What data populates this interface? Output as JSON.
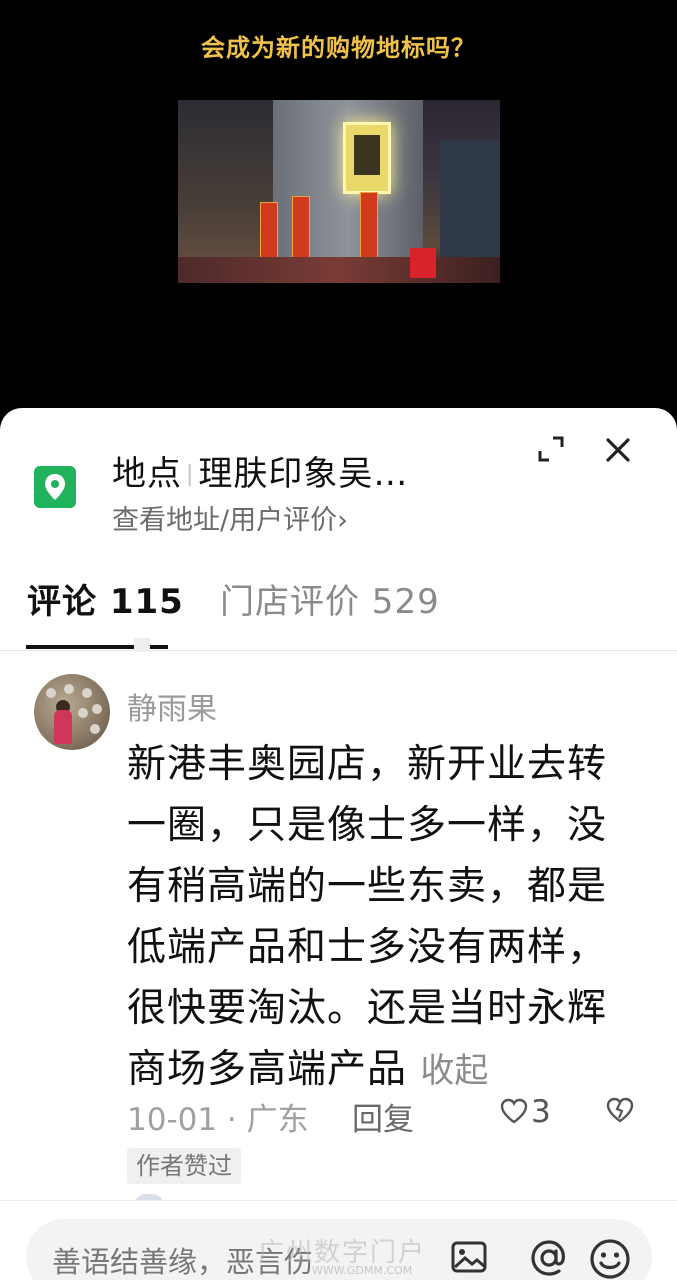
{
  "video": {
    "caption": "会成为新的购物地标吗？"
  },
  "location": {
    "label": "地点",
    "name": "理肤印象吴…",
    "subtitle": "查看地址/用户评价",
    "subtitle_chevron": "›",
    "icon": "location-pin-icon",
    "icon_color": "#21b25c"
  },
  "header_actions": {
    "expand_icon": "expand-icon",
    "close_icon": "close-icon"
  },
  "tabs": [
    {
      "label": "评论 115",
      "active": true
    },
    {
      "label": "门店评价 529",
      "active": false
    }
  ],
  "comment": {
    "username": "静雨果",
    "text": "新港丰奥园店，新开业去转一圈，只是像士多一样，没有稍高端的一些东卖，都是低端产品和士多没有两样，很快要淘汰。还是当时永辉商场多高端产品",
    "collapse_label": "收起",
    "date_location": "10-01 · 广东",
    "reply_label": "回复",
    "like_count": "3",
    "author_liked_badge": "作者赞过"
  },
  "composer": {
    "placeholder": "善语结善缘，恶言伤",
    "icons": [
      "image-icon",
      "at-icon",
      "emoji-icon"
    ]
  },
  "watermark": {
    "text": "广州数字门户",
    "sub": "WWW.GDMM.COM"
  }
}
